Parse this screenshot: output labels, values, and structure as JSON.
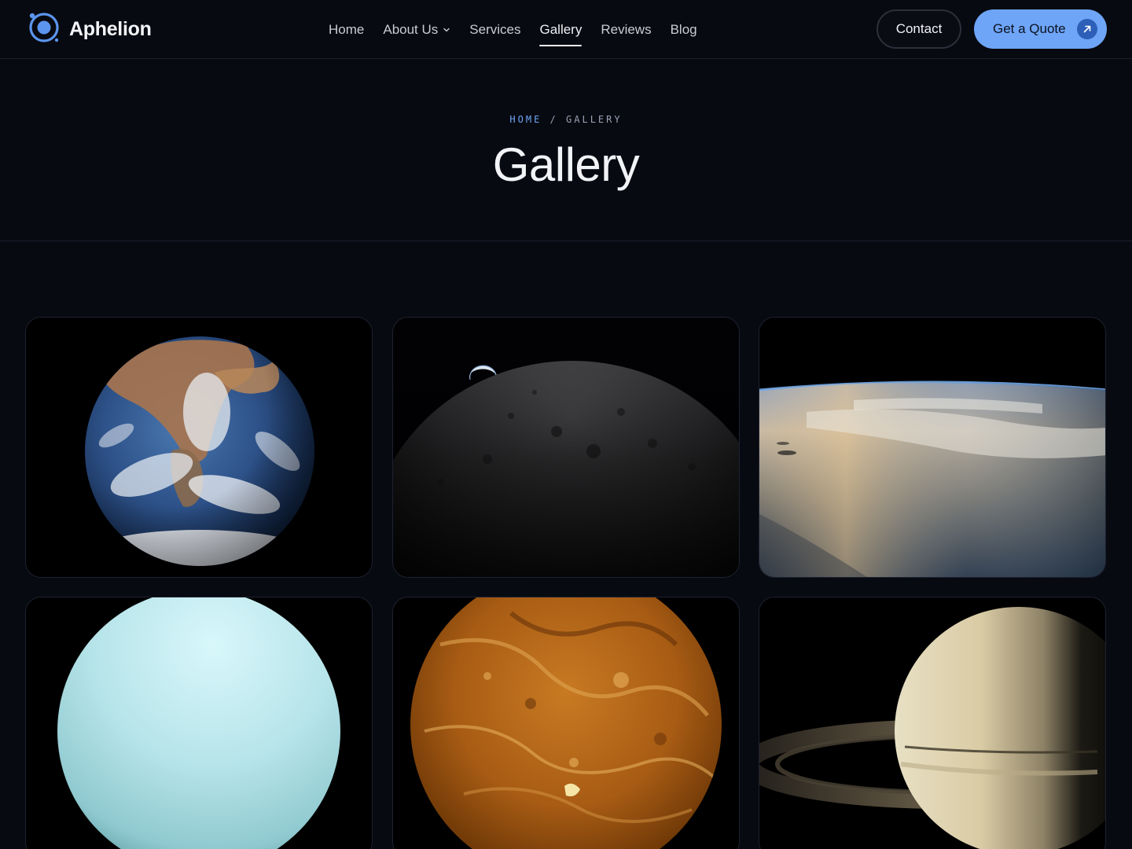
{
  "brand": {
    "name": "Aphelion"
  },
  "nav": {
    "items": [
      {
        "label": "Home"
      },
      {
        "label": "About Us"
      },
      {
        "label": "Services"
      },
      {
        "label": "Gallery"
      },
      {
        "label": "Reviews"
      },
      {
        "label": "Blog"
      }
    ],
    "active": "Gallery"
  },
  "actions": {
    "contact_label": "Contact",
    "quote_label": "Get a Quote"
  },
  "hero": {
    "breadcrumb_home": "HOME",
    "breadcrumb_separator": "/",
    "breadcrumb_current": "GALLERY",
    "title": "Gallery"
  },
  "gallery": {
    "images": [
      {
        "subject": "earth"
      },
      {
        "subject": "moon-horizon"
      },
      {
        "subject": "earth-orbit-view"
      },
      {
        "subject": "uranus"
      },
      {
        "subject": "venus"
      },
      {
        "subject": "saturn"
      }
    ]
  },
  "colors": {
    "background": "#080a11",
    "accent": "#6ea5f7",
    "border": "#1b1f2b"
  }
}
